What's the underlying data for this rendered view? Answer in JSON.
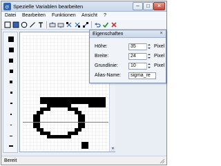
{
  "window": {
    "title": "Spezielle Variablen bearbeiten"
  },
  "menu": [
    {
      "label": "Datei"
    },
    {
      "label": "Bearbeiten"
    },
    {
      "label": "Funktionen"
    },
    {
      "label": "Ansicht"
    },
    {
      "label": "?"
    }
  ],
  "toolbar": {
    "tools": [
      "select-rect-icon",
      "filled-rect-icon",
      "ellipse-icon",
      "line-icon",
      "text-icon",
      "move-left-icon",
      "move-right-icon",
      "flip-icon",
      "rotate-icon",
      "rotate-back-icon",
      "cancel-icon",
      "ok-icon",
      "delete-icon"
    ]
  },
  "palette": {
    "sizes": [
      "1",
      "2",
      "3",
      "4",
      "5",
      "6",
      "7",
      "8",
      "9"
    ]
  },
  "properties": {
    "title": "Eigenschaften",
    "close": "×",
    "fields": [
      {
        "label": "Höhe:",
        "value": "35",
        "unit": "Pixel"
      },
      {
        "label": "Breite:",
        "value": "24",
        "unit": "Pixel"
      },
      {
        "label": "Grundlinie:",
        "value": "10",
        "unit": "Pixel"
      }
    ],
    "alias": {
      "label": "Alias-Name:",
      "value": "sigma_re"
    }
  },
  "status": {
    "text": "Bereit"
  },
  "colors": {
    "accent": "#2f64b8",
    "cancel": "#c0392b",
    "ok": "#1a8c2c",
    "baseline": "#e06060"
  }
}
